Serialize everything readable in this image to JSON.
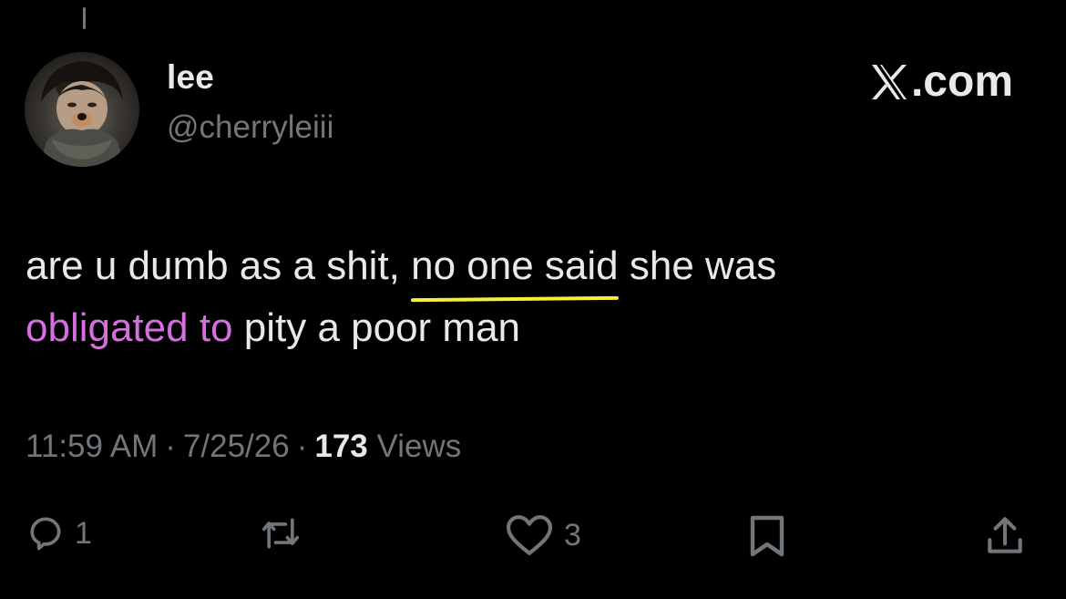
{
  "author": {
    "name": "lee",
    "handle": "@cherryleiii"
  },
  "brand": {
    "label": ".com",
    "icon": "x-logo-icon"
  },
  "tweet": {
    "part1": "are u dumb as a shit, ",
    "highlight_yellow": "no one said",
    "part2": " she was",
    "highlight_purple": "obligated to",
    "part3": " pity a poor man"
  },
  "meta": {
    "time": "11:59 AM",
    "date": "7/25/26",
    "views_count": "173",
    "views_label": "Views"
  },
  "actions": {
    "reply_count": "1",
    "repost_count": "",
    "like_count": "3"
  },
  "colors": {
    "background": "#000000",
    "text": "#e7e9ea",
    "muted": "#71767b",
    "underline": "#f4ef3b",
    "purple_highlight": "#d66ee0"
  }
}
